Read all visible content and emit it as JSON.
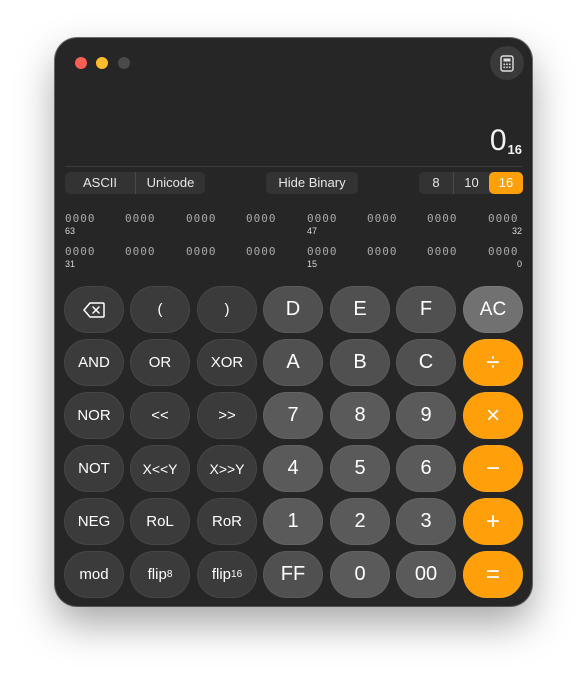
{
  "display": {
    "value": "0",
    "base_subscript": "16"
  },
  "encoding_tabs": [
    "ASCII",
    "Unicode"
  ],
  "binary_toggle": "Hide Binary",
  "bases": [
    {
      "label": "8",
      "active": false
    },
    {
      "label": "10",
      "active": false
    },
    {
      "label": "16",
      "active": true
    }
  ],
  "binary": {
    "row1": {
      "groups": [
        "0000",
        "0000",
        "0000",
        "0000",
        "0000",
        "0000",
        "0000",
        "0000"
      ],
      "idx_start": "63",
      "idx_mid": "47",
      "idx_end": "32"
    },
    "row2": {
      "groups": [
        "0000",
        "0000",
        "0000",
        "0000",
        "0000",
        "0000",
        "0000",
        "0000"
      ],
      "idx_start": "31",
      "idx_mid": "15",
      "idx_end": "0"
    }
  },
  "keys": {
    "row1": [
      "⌫",
      "(",
      ")",
      "D",
      "E",
      "F",
      "AC"
    ],
    "row2": [
      "AND",
      "OR",
      "XOR",
      "A",
      "B",
      "C",
      "÷"
    ],
    "row3": [
      "NOR",
      "<<",
      ">>",
      "7",
      "8",
      "9",
      "×"
    ],
    "row4": [
      "NOT",
      "X<<Y",
      "X>>Y",
      "4",
      "5",
      "6",
      "−"
    ],
    "row5": [
      "NEG",
      "RoL",
      "RoR",
      "1",
      "2",
      "3",
      "+"
    ],
    "row6": {
      "mod": "mod",
      "flip8": {
        "base": "flip",
        "sub": "8"
      },
      "flip16": {
        "base": "flip",
        "sub": "16"
      },
      "ff": "FF",
      "zero": "0",
      "dzero": "00",
      "eq": "="
    }
  },
  "colors": {
    "accent": "#ff9f0a",
    "window": "#262626",
    "key_fn": "#3b3b3b",
    "key_num": "#5a5a5a"
  },
  "icons": {
    "mode": "calculator-icon",
    "backspace": "backspace-icon"
  }
}
